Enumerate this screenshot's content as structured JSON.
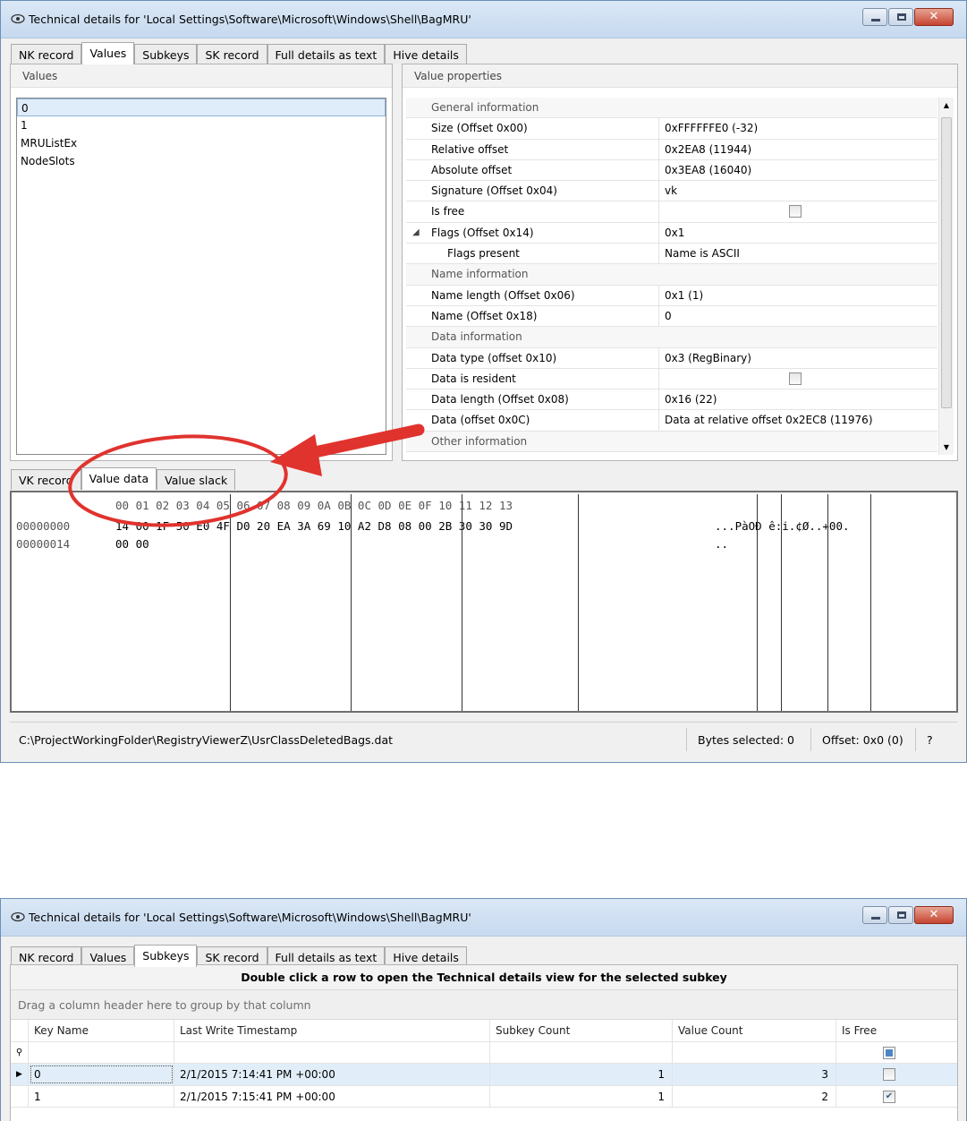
{
  "window1": {
    "title": "Technical details for 'Local Settings\\Software\\Microsoft\\Windows\\Shell\\BagMRU'",
    "tabs": [
      "NK record",
      "Values",
      "Subkeys",
      "SK record",
      "Full details as text",
      "Hive details"
    ],
    "active_tab": "Values",
    "values_panel": {
      "header": "Values",
      "items": [
        "0",
        "1",
        "MRUListEx",
        "NodeSlots"
      ],
      "selected": "0"
    },
    "properties_panel": {
      "header": "Value properties",
      "rows": [
        {
          "kind": "category",
          "name": "General information"
        },
        {
          "kind": "prop",
          "name": "Size (Offset 0x00)",
          "value": "0xFFFFFFE0 (-32)"
        },
        {
          "kind": "prop",
          "name": "Relative offset",
          "value": "0x2EA8 (11944)"
        },
        {
          "kind": "prop",
          "name": "Absolute offset",
          "value": "0x3EA8 (16040)"
        },
        {
          "kind": "prop",
          "name": "Signature (Offset 0x04)",
          "value": "vk"
        },
        {
          "kind": "prop",
          "name": "Is free",
          "value": "",
          "checkbox": true,
          "checked": false
        },
        {
          "kind": "expandable",
          "name": "Flags (Offset 0x14)",
          "value": "0x1"
        },
        {
          "kind": "child",
          "name": "Flags present",
          "value": "Name is ASCII"
        },
        {
          "kind": "category",
          "name": "Name information"
        },
        {
          "kind": "prop",
          "name": "Name length (Offset 0x06)",
          "value": "0x1 (1)"
        },
        {
          "kind": "prop",
          "name": "Name (Offset 0x18)",
          "value": "0"
        },
        {
          "kind": "category",
          "name": "Data information"
        },
        {
          "kind": "prop",
          "name": "Data type (offset 0x10)",
          "value": "0x3 (RegBinary)"
        },
        {
          "kind": "prop",
          "name": "Data is resident",
          "value": "",
          "checkbox": true,
          "checked": false
        },
        {
          "kind": "prop",
          "name": "Data length (Offset 0x08)",
          "value": "0x16 (22)"
        },
        {
          "kind": "prop",
          "name": "Data (offset 0x0C)",
          "value": "Data at relative offset 0x2EC8 (11976)"
        },
        {
          "kind": "category",
          "name": "Other information"
        }
      ]
    },
    "lower_tabs": [
      "VK record",
      "Value data",
      "Value slack"
    ],
    "active_lower_tab": "Value data",
    "hex": {
      "header": "00 01 02 03 04 05 06 07 08 09 0A 0B 0C 0D 0E 0F 10 11 12 13",
      "rows": [
        {
          "offset": "00000000",
          "bytes": "14 00 1F 50 E0 4F D0 20 EA 3A 69 10 A2 D8 08 00 2B 30 30 9D",
          "ascii": "...PàOÐ ê:i.¢Ø..+00."
        },
        {
          "offset": "00000014",
          "bytes": "00 00",
          "ascii": ".."
        }
      ]
    },
    "status": {
      "path": "C:\\ProjectWorkingFolder\\RegistryViewerZ\\UsrClassDeletedBags.dat",
      "bytes_selected": "Bytes selected: 0",
      "offset": "Offset: 0x0 (0)",
      "help": "?"
    },
    "annotation_color": "#e0332e"
  },
  "window2": {
    "title": "Technical details for 'Local Settings\\Software\\Microsoft\\Windows\\Shell\\BagMRU'",
    "tabs": [
      "NK record",
      "Values",
      "Subkeys",
      "SK record",
      "Full details as text",
      "Hive details"
    ],
    "active_tab": "Subkeys",
    "banner": "Double click a row to open the Technical details view for the selected subkey",
    "group_hint": "Drag a column header here to group by that column",
    "columns": [
      "Key Name",
      "Last Write Timestamp",
      "Subkey Count",
      "Value Count",
      "Is Free"
    ],
    "rows": [
      {
        "key": "0",
        "timestamp": "2/1/2015 7:14:41 PM +00:00",
        "subkey_count": "1",
        "value_count": "3",
        "is_free": false
      },
      {
        "key": "1",
        "timestamp": "2/1/2015 7:15:41 PM +00:00",
        "subkey_count": "1",
        "value_count": "2",
        "is_free": true
      }
    ]
  }
}
